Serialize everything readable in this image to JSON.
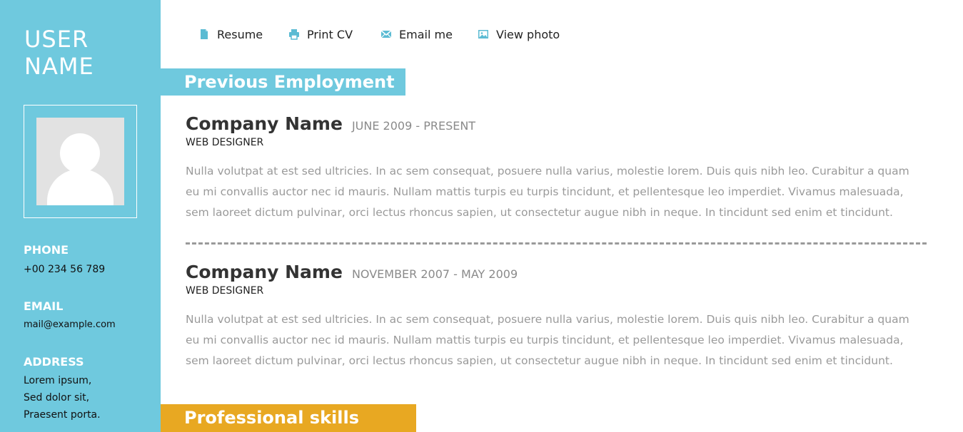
{
  "sidebar": {
    "user_name_line1": "USER",
    "user_name_line2": "NAME",
    "phone_label": "PHONE",
    "phone_value": "+00 234 56 789",
    "email_label": "EMAIL",
    "email_value": "mail@example.com",
    "address_label": "ADDRESS",
    "address_line1": "Lorem ipsum,",
    "address_line2": "Sed dolor sit,",
    "address_line3": "Praesent porta."
  },
  "nav": {
    "items": [
      {
        "label": "Resume",
        "icon": "document-icon"
      },
      {
        "label": "Print CV",
        "icon": "printer-icon"
      },
      {
        "label": "Email me",
        "icon": "envelope-icon"
      },
      {
        "label": "View photo",
        "icon": "image-icon"
      }
    ]
  },
  "sections": {
    "employment_title": "Previous Employment",
    "skills_title": "Professional skills"
  },
  "jobs": [
    {
      "company": "Company Name",
      "dates": "JUNE 2009 - PRESENT",
      "role": "WEB DESIGNER",
      "description": "Nulla volutpat at est sed ultricies. In ac sem consequat, posuere nulla varius, molestie lorem. Duis quis nibh leo. Curabitur a quam eu mi convallis auctor nec id mauris. Nullam mattis turpis eu turpis tincidunt, et pellentesque leo imperdiet. Vivamus malesuada, sem laoreet dictum pulvinar, orci lectus rhoncus sapien, ut consectetur augue nibh in neque. In tincidunt sed enim et tincidunt."
    },
    {
      "company": "Company Name",
      "dates": "NOVEMBER 2007 - MAY 2009",
      "role": "WEB DESIGNER",
      "description": "Nulla volutpat at est sed ultricies. In ac sem consequat, posuere nulla varius, molestie lorem. Duis quis nibh leo. Curabitur a quam eu mi convallis auctor nec id mauris. Nullam mattis turpis eu turpis tincidunt, et pellentesque leo imperdiet. Vivamus malesuada, sem laoreet dictum pulvinar, orci lectus rhoncus sapien, ut consectetur augue nibh in neque. In tincidunt sed enim et tincidunt."
    }
  ],
  "colors": {
    "sidebar_blue": "#6fc9de",
    "skills_orange": "#e8a822",
    "icon_blue": "#5bbbd3"
  }
}
